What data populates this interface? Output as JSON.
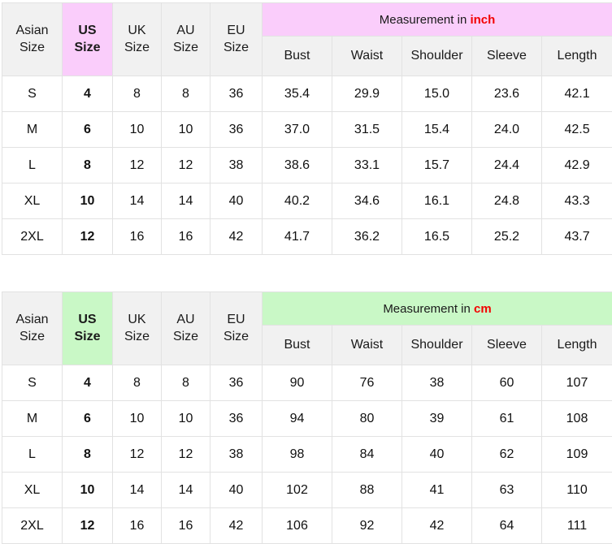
{
  "tables": [
    {
      "id": "inch-table",
      "accent_color": "#facdfb",
      "unit_color": "#f30000",
      "banner_prefix": "Measurement in ",
      "banner_unit": "inch",
      "size_headers": [
        {
          "line1": "Asian",
          "line2": "Size"
        },
        {
          "line1": "US",
          "line2": "Size"
        },
        {
          "line1": "UK",
          "line2": "Size"
        },
        {
          "line1": "AU",
          "line2": "Size"
        },
        {
          "line1": "EU",
          "line2": "Size"
        }
      ],
      "measure_headers": [
        "Bust",
        "Waist",
        "Shoulder",
        "Sleeve",
        "Length"
      ],
      "rows": [
        {
          "asian": "S",
          "us": "4",
          "uk": "8",
          "au": "8",
          "eu": "36",
          "bust": "35.4",
          "waist": "29.9",
          "shoulder": "15.0",
          "sleeve": "23.6",
          "length": "42.1"
        },
        {
          "asian": "M",
          "us": "6",
          "uk": "10",
          "au": "10",
          "eu": "36",
          "bust": "37.0",
          "waist": "31.5",
          "shoulder": "15.4",
          "sleeve": "24.0",
          "length": "42.5"
        },
        {
          "asian": "L",
          "us": "8",
          "uk": "12",
          "au": "12",
          "eu": "38",
          "bust": "38.6",
          "waist": "33.1",
          "shoulder": "15.7",
          "sleeve": "24.4",
          "length": "42.9"
        },
        {
          "asian": "XL",
          "us": "10",
          "uk": "14",
          "au": "14",
          "eu": "40",
          "bust": "40.2",
          "waist": "34.6",
          "shoulder": "16.1",
          "sleeve": "24.8",
          "length": "43.3"
        },
        {
          "asian": "2XL",
          "us": "12",
          "uk": "16",
          "au": "16",
          "eu": "42",
          "bust": "41.7",
          "waist": "36.2",
          "shoulder": "16.5",
          "sleeve": "25.2",
          "length": "43.7"
        }
      ]
    },
    {
      "id": "cm-table",
      "accent_color": "#c9f8c6",
      "unit_color": "#f30000",
      "banner_prefix": "Measurement in ",
      "banner_unit": "cm",
      "size_headers": [
        {
          "line1": "Asian",
          "line2": "Size"
        },
        {
          "line1": "US",
          "line2": "Size"
        },
        {
          "line1": "UK",
          "line2": "Size"
        },
        {
          "line1": "AU",
          "line2": "Size"
        },
        {
          "line1": "EU",
          "line2": "Size"
        }
      ],
      "measure_headers": [
        "Bust",
        "Waist",
        "Shoulder",
        "Sleeve",
        "Length"
      ],
      "rows": [
        {
          "asian": "S",
          "us": "4",
          "uk": "8",
          "au": "8",
          "eu": "36",
          "bust": "90",
          "waist": "76",
          "shoulder": "38",
          "sleeve": "60",
          "length": "107"
        },
        {
          "asian": "M",
          "us": "6",
          "uk": "10",
          "au": "10",
          "eu": "36",
          "bust": "94",
          "waist": "80",
          "shoulder": "39",
          "sleeve": "61",
          "length": "108"
        },
        {
          "asian": "L",
          "us": "8",
          "uk": "12",
          "au": "12",
          "eu": "38",
          "bust": "98",
          "waist": "84",
          "shoulder": "40",
          "sleeve": "62",
          "length": "109"
        },
        {
          "asian": "XL",
          "us": "10",
          "uk": "14",
          "au": "14",
          "eu": "40",
          "bust": "102",
          "waist": "88",
          "shoulder": "41",
          "sleeve": "63",
          "length": "110"
        },
        {
          "asian": "2XL",
          "us": "12",
          "uk": "16",
          "au": "16",
          "eu": "42",
          "bust": "106",
          "waist": "92",
          "shoulder": "42",
          "sleeve": "64",
          "length": "111"
        }
      ]
    }
  ]
}
